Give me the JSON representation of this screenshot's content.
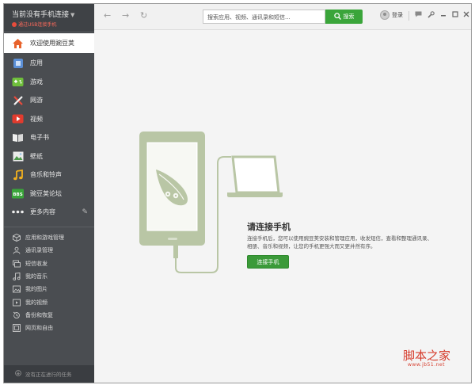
{
  "sidebar": {
    "device_name": "当前没有手机连接",
    "device_status": "通过USB连接手机",
    "nav": [
      {
        "label": "欢迎使用豌豆荚",
        "icon": "home-icon"
      },
      {
        "label": "应用",
        "icon": "apps-icon"
      },
      {
        "label": "游戏",
        "icon": "gamepad-icon"
      },
      {
        "label": "网游",
        "icon": "swords-icon"
      },
      {
        "label": "视频",
        "icon": "video-play-icon"
      },
      {
        "label": "电子书",
        "icon": "book-icon"
      },
      {
        "label": "壁纸",
        "icon": "wallpaper-icon"
      },
      {
        "label": "音乐和铃声",
        "icon": "music-icon"
      },
      {
        "label": "豌豆荚论坛",
        "icon": "bbs-icon",
        "badge": "BBS"
      },
      {
        "label": "更多内容",
        "icon": "more-dots-icon"
      }
    ],
    "tools": [
      {
        "label": "应用和游戏管理",
        "icon": "cube-icon"
      },
      {
        "label": "通讯录管理",
        "icon": "contacts-icon"
      },
      {
        "label": "短信收发",
        "icon": "sms-icon"
      },
      {
        "label": "我的音乐",
        "icon": "note-icon"
      },
      {
        "label": "我的图片",
        "icon": "picture-icon"
      },
      {
        "label": "我的视频",
        "icon": "film-icon"
      },
      {
        "label": "备份和恢复",
        "icon": "backup-icon"
      },
      {
        "label": "网页和自由",
        "icon": "web-icon"
      }
    ],
    "footer": "没有正在进行的任务"
  },
  "toolbar": {
    "search_placeholder": "搜索应用、视频、通讯录和短信...",
    "search_button": "搜索",
    "login": "登录"
  },
  "main": {
    "title": "请连接手机",
    "description": "连接手机后，您可以使用豌豆荚安装和管理应用，收发短信，查看和整理通讯录、相册、音乐和视频，让您的手机更强大而又更井然有序。",
    "connect_button": "连接手机"
  },
  "watermark": {
    "text": "脚本之家",
    "url": "www.jb51.net"
  },
  "colors": {
    "sidebar_bg": "#4a4d51",
    "accent_green": "#3aa53a",
    "illustration_green": "#b9c6a5",
    "status_red": "#e74c3c"
  }
}
